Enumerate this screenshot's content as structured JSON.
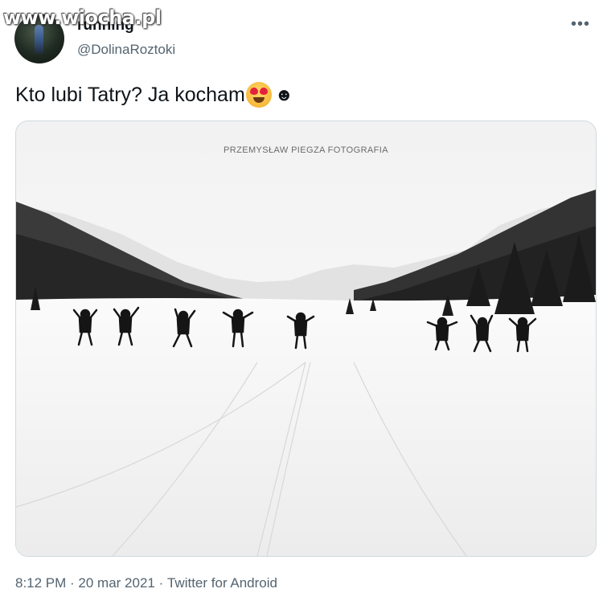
{
  "watermark": "www.wiocha.pl",
  "author": {
    "name": "running",
    "handle": "@DolinaRoztoki"
  },
  "more_icon": "more-dots-icon",
  "tweet": {
    "text": "Kto lubi Tatry? Ja kocham",
    "emojis": [
      "heart-eyes-emoji",
      "smiley-emoji"
    ],
    "smiley": "☻"
  },
  "photo": {
    "credit": "PRZEMYSŁAW PIEGZA FOTOGRAFIA"
  },
  "meta": {
    "time": "8:12 PM",
    "separator1": " · ",
    "date": "20 mar 2021",
    "separator2": " · ",
    "source": "Twitter for Android"
  },
  "colors": {
    "text": "#0f1419",
    "secondary": "#536471",
    "border": "#cfd9de"
  }
}
